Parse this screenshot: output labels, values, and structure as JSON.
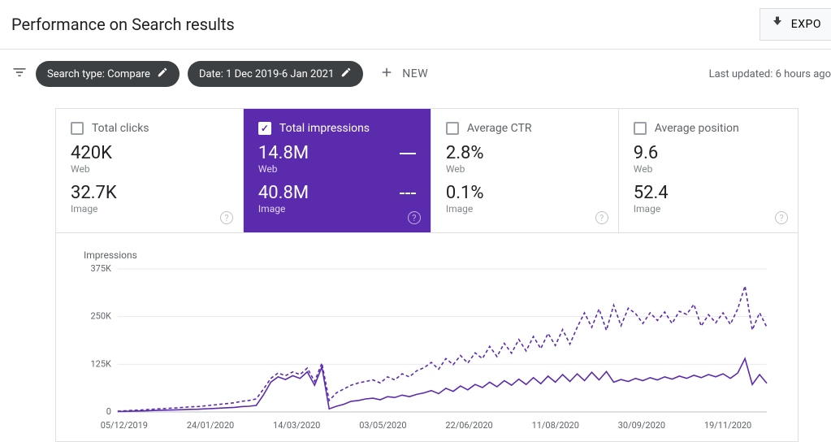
{
  "header": {
    "title": "Performance on Search results",
    "export_label": "EXPO"
  },
  "filters": {
    "search_type_chip": "Search type: Compare",
    "date_chip": "Date: 1 Dec 2019-6 Jan 2021",
    "new_label": "NEW",
    "last_updated": "Last updated: 6 hours ago"
  },
  "cards": [
    {
      "title": "Total clicks",
      "web_val": "420K",
      "web_sub": "Web",
      "img_val": "32.7K",
      "img_sub": "Image",
      "active": false
    },
    {
      "title": "Total impressions",
      "web_val": "14.8M",
      "web_sub": "Web",
      "img_val": "40.8M",
      "img_sub": "Image",
      "active": true
    },
    {
      "title": "Average CTR",
      "web_val": "2.8%",
      "web_sub": "Web",
      "img_val": "0.1%",
      "img_sub": "Image",
      "active": false
    },
    {
      "title": "Average position",
      "web_val": "9.6",
      "web_sub": "Web",
      "img_val": "52.4",
      "img_sub": "Image",
      "active": false
    }
  ],
  "chart_data": {
    "type": "line",
    "title": "Impressions",
    "ylabel": "Impressions",
    "xlabel": "",
    "ylim": [
      0,
      375000
    ],
    "y_ticks": [
      "0",
      "125K",
      "250K",
      "375K"
    ],
    "x_ticks": [
      "05/12/2019",
      "24/01/2020",
      "14/03/2020",
      "03/05/2020",
      "22/06/2020",
      "11/08/2020",
      "30/09/2020",
      "19/11/2020"
    ],
    "series": [
      {
        "name": "Web",
        "style": "solid",
        "values": [
          1000,
          1500,
          2000,
          2500,
          3000,
          3800,
          4500,
          5000,
          5500,
          6000,
          6800,
          7000,
          8000,
          9000,
          10000,
          11000,
          12000,
          14000,
          15000,
          17000,
          45000,
          78000,
          92000,
          85000,
          95000,
          88000,
          105000,
          70000,
          118000,
          8000,
          15000,
          20000,
          28000,
          30000,
          34000,
          36000,
          32000,
          40000,
          38000,
          44000,
          40000,
          46000,
          50000,
          56000,
          48000,
          62000,
          54000,
          68000,
          58000,
          72000,
          64000,
          78000,
          66000,
          82000,
          70000,
          86000,
          72000,
          90000,
          74000,
          94000,
          78000,
          98000,
          80000,
          100000,
          82000,
          104000,
          84000,
          106000,
          78000,
          85000,
          80000,
          88000,
          82000,
          90000,
          84000,
          92000,
          86000,
          94000,
          88000,
          96000,
          90000,
          98000,
          92000,
          100000,
          88000,
          102000,
          140000,
          72000,
          98000,
          75000
        ]
      },
      {
        "name": "Image",
        "style": "dashed",
        "values": [
          2000,
          3000,
          4000,
          5000,
          6000,
          7500,
          8500,
          9500,
          10500,
          12000,
          13500,
          14000,
          16000,
          18000,
          20000,
          22000,
          24000,
          28000,
          30000,
          34000,
          60000,
          88000,
          102000,
          95000,
          105000,
          98000,
          115000,
          80000,
          128000,
          30000,
          50000,
          60000,
          70000,
          76000,
          80000,
          84000,
          76000,
          92000,
          84000,
          100000,
          92000,
          108000,
          116000,
          130000,
          112000,
          140000,
          124000,
          148000,
          128000,
          155000,
          140000,
          172000,
          145000,
          180000,
          154000,
          190000,
          160000,
          198000,
          166000,
          206000,
          174000,
          216000,
          178000,
          222000,
          260000,
          222000,
          270000,
          214000,
          280000,
          226000,
          272000,
          258000,
          232000,
          260000,
          240000,
          262000,
          232000,
          264000,
          256000,
          282000,
          225000,
          255000,
          234000,
          260000,
          230000,
          270000,
          330000,
          215000,
          260000,
          222000
        ]
      }
    ]
  }
}
